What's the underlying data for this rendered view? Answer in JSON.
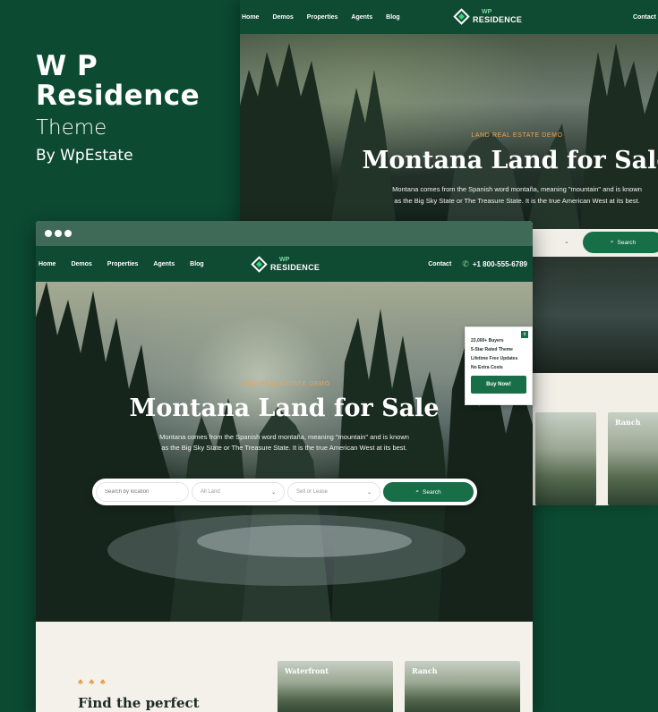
{
  "promo": {
    "title_line1": "W P",
    "title_line2": "Residence",
    "subtitle": "Theme",
    "byline": "By WpEstate"
  },
  "nav": {
    "links": [
      "Home",
      "Demos",
      "Properties",
      "Agents",
      "Blog"
    ],
    "logo_line1": "WP",
    "logo_line2": "RESIDENCE",
    "contact": "Contact",
    "phone": "+1 800-555-6789",
    "phone_icon": "phone-icon"
  },
  "hero": {
    "kicker": "LAND REAL ESTATE DEMO",
    "title": "Montana Land for Sale",
    "desc_line1": "Montana comes from the Spanish word montaña, meaning \"mountain\" and is known",
    "desc_line2": "as the Big Sky State or The Treasure State. It is the true American West at its best."
  },
  "search": {
    "location_placeholder": "Search by location",
    "type_value": "All Land",
    "mode_value": "Sell or Lease",
    "button_label": "Search",
    "search_icon": "search-icon"
  },
  "popup": {
    "close": "x",
    "items": [
      "23,000+ Buyers",
      "5-Star Rated Theme",
      "Lifetime Free Updates",
      "No Extra Costs"
    ],
    "button_label": "Buy Now!"
  },
  "lower": {
    "kicker": "♣ ♣ ♣",
    "title": "Find the perfect",
    "cards": [
      "Waterfront",
      "Ranch"
    ]
  },
  "colors": {
    "brand_green": "#0f4a33",
    "accent_green": "#176e47",
    "accent_orange": "#e59b3d",
    "cream": "#f4f1ea"
  }
}
